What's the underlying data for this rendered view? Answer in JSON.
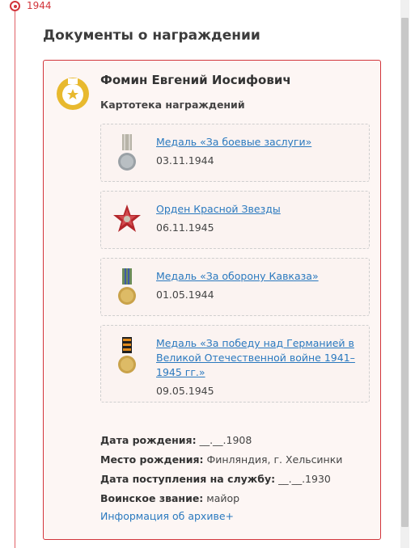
{
  "timeline": {
    "year": "1944"
  },
  "section": {
    "title": "Документы о награждении"
  },
  "person": {
    "name": "Фомин Евгений Иосифович",
    "subtitle": "Картотека награждений"
  },
  "awards": [
    {
      "name": "Медаль «За боевые заслуги»",
      "date": "03.11.1944",
      "icon": "medal-combat-merit-icon"
    },
    {
      "name": "Орден Красной Звезды",
      "date": "06.11.1945",
      "icon": "order-red-star-icon"
    },
    {
      "name": "Медаль «За оборону Кавказа»",
      "date": "01.05.1944",
      "icon": "medal-caucasus-defense-icon"
    },
    {
      "name_line1": "Медаль «За победу над Германией в",
      "name_line2": "Великой Отечественной войне 1941–",
      "name_line3": "1945 гг.»",
      "date": "09.05.1945",
      "icon": "medal-victory-germany-icon"
    }
  ],
  "details": {
    "birth_date_label": "Дата рождения:",
    "birth_date_value": "__.__.1908",
    "birth_place_label": "Место рождения:",
    "birth_place_value": "Финляндия, г. Хельсинки",
    "service_label": "Дата поступления на службу:",
    "service_value": "__.__.1930",
    "rank_label": "Воинское звание:",
    "rank_value": "майор"
  },
  "archive_link": "Информация об архиве+",
  "colors": {
    "accent": "#d2353b",
    "link": "#2a79bf",
    "card_bg": "#fdf6f4"
  }
}
